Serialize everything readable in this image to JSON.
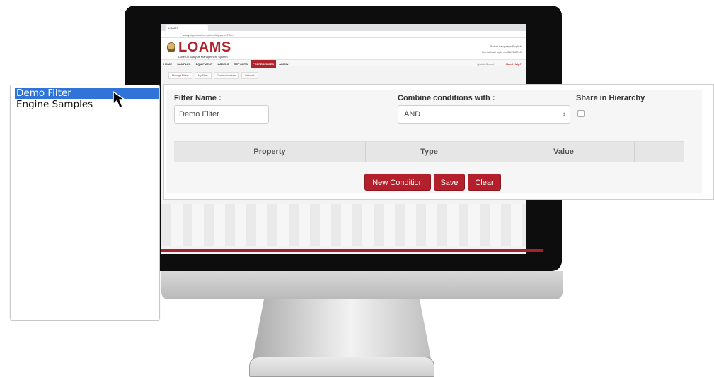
{
  "browser": {
    "tab_title": "LOAMS",
    "address": "analysisplusonline.net/settings/userFilter"
  },
  "app": {
    "logo_text": "LOAMS",
    "logo_subtitle": "Lube Oil Analysis Management System",
    "header_lang": "Select Language",
    "header_lang_value": "English",
    "header_user": "Demo",
    "header_last_login": "Last login on 06/26/2019",
    "nav": [
      "HOME",
      "SAMPLES",
      "EQUIPMENT",
      "LABELS",
      "REPORTS",
      "PREFERENCES",
      "ADMIN"
    ],
    "nav_active": "PREFERENCES",
    "quick_search": "Quick Search",
    "need_help": "Need Help?",
    "subtabs": [
      "Manage Filters",
      "My Filter",
      "Communications",
      "Network"
    ]
  },
  "filter_list": {
    "items": [
      {
        "label": "Demo Filter",
        "selected": true
      },
      {
        "label": "Engine Samples",
        "selected": false
      }
    ]
  },
  "filter_form": {
    "name_label": "Filter Name :",
    "name_value": "Demo Filter",
    "combine_label": "Combine conditions with :",
    "combine_value": "AND",
    "share_label": "Share in Hierarchy",
    "share_checked": false,
    "columns": [
      "Property",
      "Type",
      "Value",
      ""
    ],
    "buttons": {
      "new_condition": "New Condition",
      "save": "Save",
      "clear": "Clear"
    }
  },
  "colors": {
    "brand_red": "#b3202c",
    "selection_blue": "#2f74d6"
  }
}
